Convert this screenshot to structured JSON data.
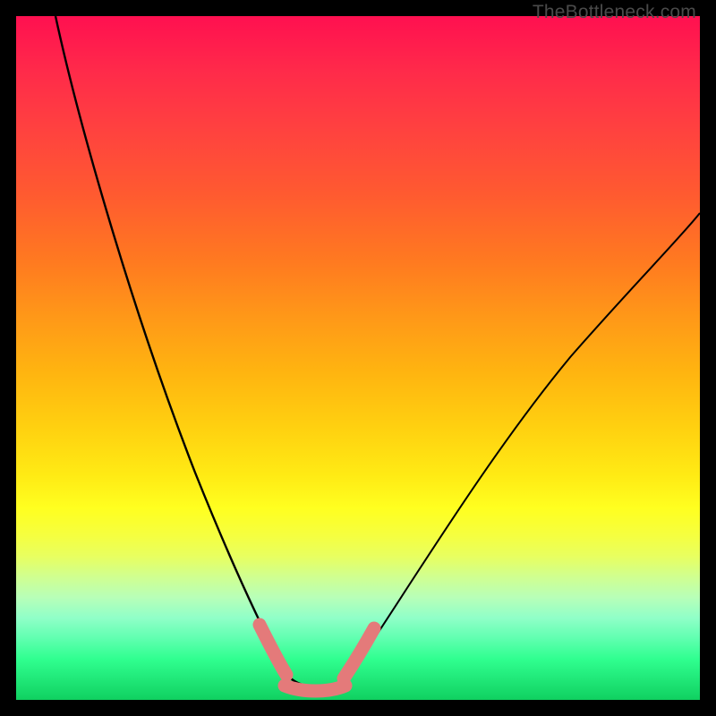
{
  "watermark": "TheBottleneck.com",
  "colors": {
    "curve": "#000000",
    "marker": "#e47a7a",
    "gradient_top": "#ff1050",
    "gradient_bottom": "#10d060"
  },
  "chart_data": {
    "type": "line",
    "title": "",
    "xlabel": "",
    "ylabel": "",
    "xlim": [
      0,
      100
    ],
    "ylim": [
      0,
      100
    ],
    "grid": false,
    "legend": false,
    "note": "Axes are unlabeled; x and y are relative percentages of the plot area. y=0 is green (optimal), y=100 is red (severe bottleneck). Values estimated from curve geometry.",
    "series": [
      {
        "name": "left-branch",
        "x": [
          5,
          10,
          15,
          20,
          25,
          30,
          35,
          38,
          40
        ],
        "y": [
          100,
          80,
          62,
          46,
          32,
          20,
          10,
          5,
          2
        ]
      },
      {
        "name": "flat-bottom",
        "x": [
          40,
          44,
          48
        ],
        "y": [
          2,
          1,
          2
        ]
      },
      {
        "name": "right-branch",
        "x": [
          48,
          55,
          62,
          70,
          78,
          86,
          94,
          100
        ],
        "y": [
          2,
          10,
          20,
          32,
          44,
          55,
          65,
          72
        ]
      }
    ],
    "markers": [
      {
        "name": "marker-left-descent",
        "x": [
          35.5,
          36.3,
          37.1,
          37.9,
          38.6,
          39.3,
          40.0
        ],
        "y": [
          10,
          8.3,
          6.7,
          5.2,
          3.9,
          2.8,
          2.0
        ]
      },
      {
        "name": "marker-bottom",
        "x": [
          40,
          41,
          42,
          43,
          44,
          45,
          46,
          47,
          48
        ],
        "y": [
          2.0,
          1.6,
          1.3,
          1.1,
          1.0,
          1.1,
          1.3,
          1.6,
          2.0
        ]
      },
      {
        "name": "marker-right-ascent",
        "x": [
          48.0,
          48.8,
          49.6,
          50.4,
          51.2,
          52.0
        ],
        "y": [
          2.0,
          3.0,
          4.2,
          5.5,
          7.0,
          8.6
        ]
      }
    ]
  }
}
